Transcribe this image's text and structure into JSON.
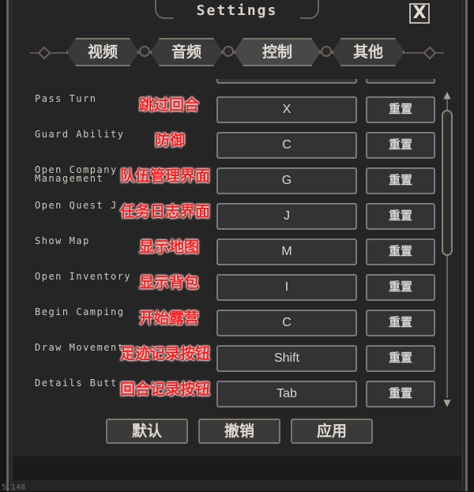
{
  "window": {
    "title": "Settings",
    "close_label": "X"
  },
  "tabs": [
    {
      "label": "视频",
      "active": false
    },
    {
      "label": "音频",
      "active": false
    },
    {
      "label": "控制",
      "active": true
    },
    {
      "label": "其他",
      "active": false
    }
  ],
  "bindings": [
    {
      "action": "Pass Turn",
      "annotation": "跳过回合",
      "key": "X",
      "reset": "重置"
    },
    {
      "action": "Guard Ability",
      "annotation": "防御",
      "key": "C",
      "reset": "重置"
    },
    {
      "action": "Open Company\nManagement",
      "annotation": "队伍管理界面",
      "key": "G",
      "reset": "重置"
    },
    {
      "action": "Open Quest J",
      "annotation": "任务日志界面",
      "key": "J",
      "reset": "重置"
    },
    {
      "action": "Show Map",
      "annotation": "显示地图",
      "key": "M",
      "reset": "重置"
    },
    {
      "action": "Open Inventory",
      "annotation": "显示背包",
      "key": "I",
      "reset": "重置"
    },
    {
      "action": "Begin Camping",
      "annotation": "开始露营",
      "key": "C",
      "reset": "重置"
    },
    {
      "action": "Draw Movement",
      "annotation": "足迹记录按钮",
      "key": "Shift",
      "reset": "重置"
    },
    {
      "action": "Details Butt",
      "annotation": "回合记录按钮",
      "key": "Tab",
      "reset": "重置"
    }
  ],
  "footer": {
    "default_label": "默认",
    "cancel_label": "撤销",
    "apply_label": "应用"
  },
  "version_text": "5.148",
  "scrollbar": {
    "position": 0.05,
    "visible_fraction": 0.5
  }
}
